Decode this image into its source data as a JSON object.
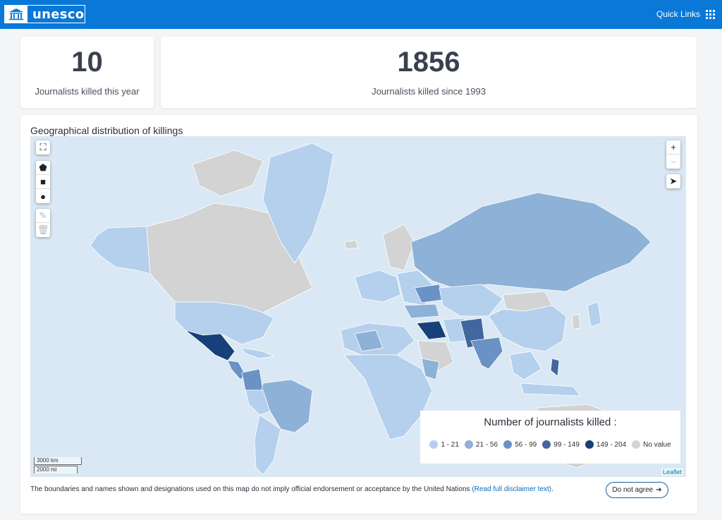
{
  "header": {
    "logo_text": "unesco",
    "quick_links_label": "Quick Links"
  },
  "stats": {
    "this_year": {
      "value": "10",
      "label": "Journalists killed this year"
    },
    "since_1993": {
      "value": "1856",
      "label": "Journalists killed since 1993"
    }
  },
  "map": {
    "title": "Geographical distribution of killings",
    "controls": {
      "fullscreen_icon": "fullscreen-icon",
      "draw_tools": [
        "draw-polygon-icon",
        "draw-rectangle-icon",
        "draw-circle-icon",
        "edit-layers-icon",
        "delete-layers-icon"
      ],
      "zoom_in": "+",
      "zoom_out": "−",
      "locate_icon": "locate-arrow-icon"
    },
    "scale": {
      "km": "3000 km",
      "mi": "2000 mi"
    },
    "attribution": "Leaflet",
    "legend": {
      "title": "Number of journalists killed :",
      "items": [
        {
          "label": "1 - 21",
          "color": "#b4d0ec"
        },
        {
          "label": "21 - 56",
          "color": "#8eb1d8"
        },
        {
          "label": "56 - 99",
          "color": "#6a92c4"
        },
        {
          "label": "99 - 149",
          "color": "#40679f"
        },
        {
          "label": "149 - 204",
          "color": "#173f79"
        },
        {
          "label": "No value",
          "color": "#d3d3d3"
        }
      ]
    },
    "colors": {
      "ocean": "#d9e8f4",
      "no_value": "#d3d3d3"
    }
  },
  "disclaimer": {
    "text": "The boundaries and names shown and designations used on this map do not imply official endorsement or acceptance by the United Nations",
    "link_text": "(Read full disclaimer text)",
    "suffix": "."
  },
  "buttons": {
    "do_not_agree": "Do not agree"
  }
}
